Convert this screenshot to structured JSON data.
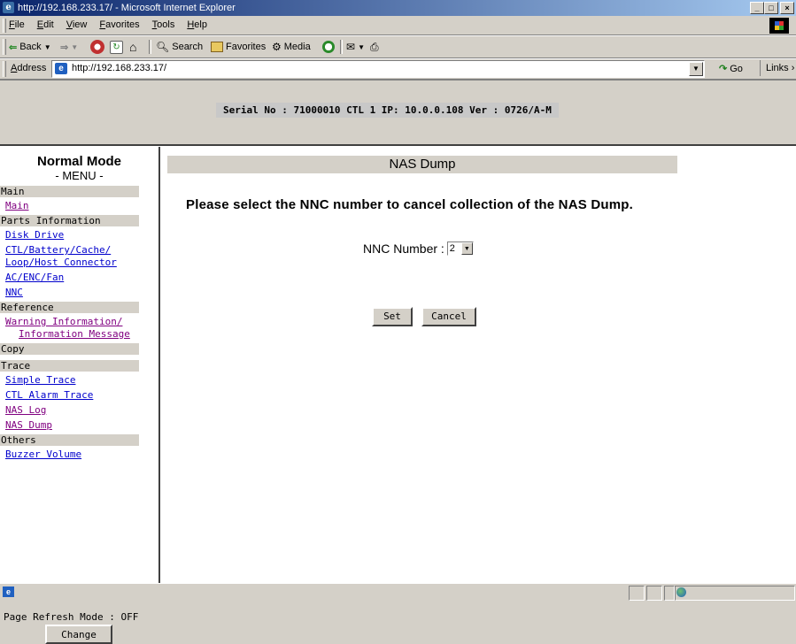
{
  "window": {
    "title": "http://192.168.233.17/ - Microsoft Internet Explorer"
  },
  "menubar": [
    "File",
    "Edit",
    "View",
    "Favorites",
    "Tools",
    "Help"
  ],
  "toolbar": {
    "back": "Back",
    "search": "Search",
    "favorites": "Favorites",
    "media": "Media"
  },
  "address": {
    "label": "Address",
    "url": "http://192.168.233.17/",
    "go": "Go",
    "links": "Links"
  },
  "header": {
    "serial": "Serial No : 71000010  CTL 1  IP: 10.0.0.108  Ver : 0726/A-M"
  },
  "sidebar": {
    "mode": "Normal Mode",
    "menu_word": "- MENU -",
    "sections": [
      {
        "title": "Main",
        "links": [
          {
            "label": "Main",
            "visited": true
          }
        ]
      },
      {
        "title": "Parts Information",
        "links": [
          {
            "label": "Disk Drive",
            "visited": false
          },
          {
            "label": "CTL/Battery/Cache/",
            "visited": false
          },
          {
            "label": "Loop/Host Connector",
            "visited": false,
            "cont": true
          },
          {
            "label": "AC/ENC/Fan",
            "visited": false
          },
          {
            "label": "NNC",
            "visited": false
          }
        ]
      },
      {
        "title": "Reference",
        "links": [
          {
            "label": "Warning Information/",
            "visited": true
          },
          {
            "label": "Information Message",
            "visited": true,
            "indent": true
          }
        ]
      },
      {
        "title": "Copy",
        "links": []
      },
      {
        "title": "Trace",
        "links": [
          {
            "label": "Simple Trace",
            "visited": false
          },
          {
            "label": "CTL Alarm Trace",
            "visited": false
          },
          {
            "label": "NAS Log",
            "visited": true
          },
          {
            "label": "NAS Dump",
            "visited": true
          }
        ]
      },
      {
        "title": "Others",
        "links": [
          {
            "label": "Buzzer Volume",
            "visited": false
          }
        ]
      }
    ],
    "refresh_mode": "Page Refresh Mode : OFF",
    "change_label": "Change"
  },
  "main": {
    "title": "NAS Dump",
    "instruction": "Please select the NNC number to cancel collection of the NAS Dump.",
    "nnc_label": "NNC Number :",
    "nnc_value": "2",
    "set_label": "Set",
    "cancel_label": "Cancel"
  },
  "colors": {
    "link": "#0000cc",
    "visited": "#800080",
    "chrome": "#d4d0c8"
  }
}
